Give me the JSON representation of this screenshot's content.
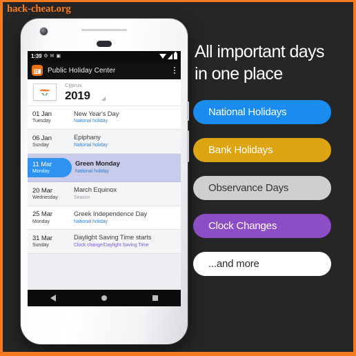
{
  "watermark": "hack-cheat.org",
  "panel": {
    "headline_line1": "All important days",
    "headline_line2": "in one place",
    "buttons": [
      {
        "label": "National Holidays",
        "color": "#1a8cf0"
      },
      {
        "label": "Bank Holidays",
        "color": "#dda513"
      },
      {
        "label": "Observance Days",
        "color": "#cfcfcf"
      },
      {
        "label": "Clock Changes",
        "color": "#8d4dc4"
      },
      {
        "label": "...and more",
        "color": "#ffffff"
      }
    ]
  },
  "phone": {
    "statusbar": {
      "time": "1:39",
      "icons": [
        "gear-icon",
        "mail-icon",
        "sdcard-icon"
      ],
      "right_icons": [
        "wifi-icon",
        "signal-icon",
        "battery-icon"
      ]
    },
    "appbar": {
      "icon": "calendar-app-icon",
      "title": "Public Holiday Center",
      "overflow": "overflow-menu-icon"
    },
    "country_header": {
      "flag": "cyprus-flag",
      "country": "Cyprus",
      "year": "2019",
      "caret": "dropdown-caret-icon"
    },
    "holidays": [
      {
        "date": "01 Jan",
        "weekday": "Tuesday",
        "name": "New Year's Day",
        "type": "National holiday",
        "type_class": "t-national",
        "row_class": "alt-white",
        "selected": false
      },
      {
        "date": "06 Jan",
        "weekday": "Sunday",
        "name": "Epiphany",
        "type": "National holiday",
        "type_class": "t-national",
        "row_class": "alt-gray",
        "selected": false
      },
      {
        "date": "11 Mar",
        "weekday": "Monday",
        "name": "Green Monday",
        "type": "National holiday",
        "type_class": "t-national",
        "row_class": "selected",
        "selected": true
      },
      {
        "date": "20 Mar",
        "weekday": "Wednesday",
        "name": "March Equinox",
        "type": "Season",
        "type_class": "t-season",
        "row_class": "alt-gray",
        "selected": false
      },
      {
        "date": "25 Mar",
        "weekday": "Monday",
        "name": "Greek Independence Day",
        "type": "National holiday",
        "type_class": "t-national",
        "row_class": "alt-white",
        "selected": false
      },
      {
        "date": "31 Mar",
        "weekday": "Sunday",
        "name": "Daylight Saving Time starts",
        "type": "Clock change/Daylight Saving Time",
        "type_class": "t-clock",
        "row_class": "alt-gray",
        "selected": false
      }
    ],
    "navbar": {
      "back": "back-icon",
      "home": "home-icon",
      "recents": "recents-icon"
    }
  }
}
